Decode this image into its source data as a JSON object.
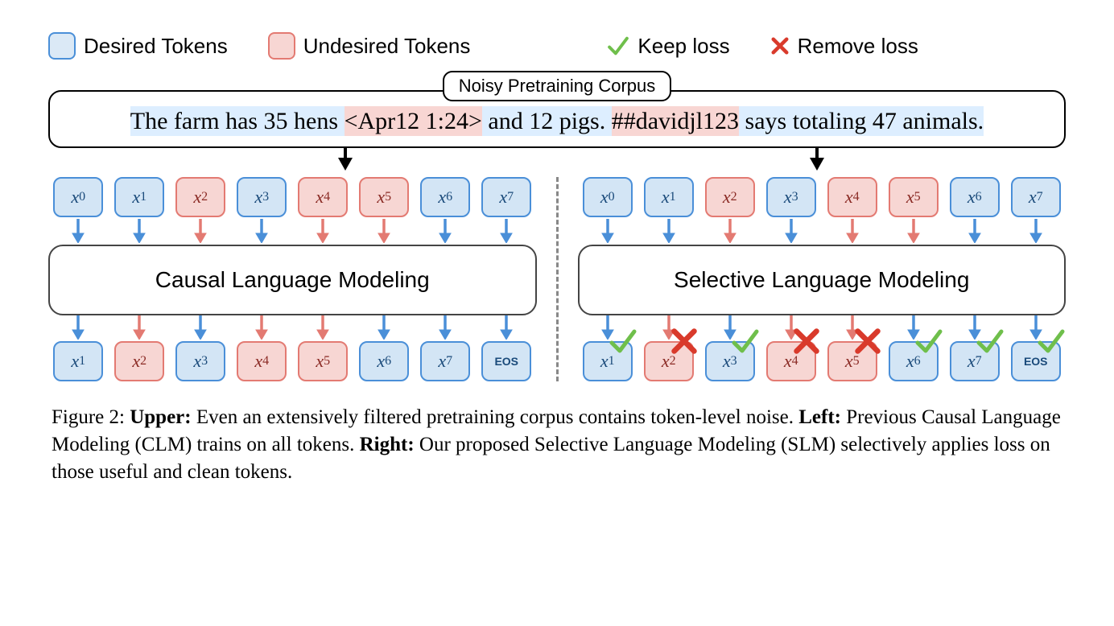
{
  "legend": {
    "desired": "Desired Tokens",
    "undesired": "Undesired Tokens",
    "keep": "Keep loss",
    "remove": "Remove loss"
  },
  "corpus": {
    "title": "Noisy Pretraining Corpus",
    "seg1": "The farm has 35 hens ",
    "seg2": "<Apr12 1:24>",
    "seg3": " and 12 pigs. ",
    "seg4": "##davidjl123",
    "seg5": " says totaling 47 animals."
  },
  "tokens": {
    "input": [
      "x0",
      "x1",
      "x2",
      "x3",
      "x4",
      "x5",
      "x6",
      "x7"
    ],
    "output": [
      "x1",
      "x2",
      "x3",
      "x4",
      "x5",
      "x6",
      "x7",
      "EOS"
    ],
    "input_desired": [
      true,
      true,
      false,
      true,
      false,
      false,
      true,
      true
    ],
    "output_desired": [
      true,
      false,
      true,
      false,
      false,
      true,
      true,
      true
    ],
    "right_output_marks": [
      "check",
      "cross",
      "check",
      "cross",
      "cross",
      "check",
      "check",
      "check"
    ]
  },
  "model": {
    "left": "Causal Language Modeling",
    "right": "Selective Language Modeling"
  },
  "caption": {
    "figlabel": "Figure 2:",
    "upper_label": "Upper:",
    "upper_text": " Even an extensively filtered pretraining corpus contains token-level noise. ",
    "left_label": "Left:",
    "left_text": " Previous Causal Language Modeling (CLM) trains on all tokens. ",
    "right_label": "Right:",
    "right_text": " Our proposed Selective Language Modeling (SLM) selectively applies loss on those useful and clean tokens."
  }
}
